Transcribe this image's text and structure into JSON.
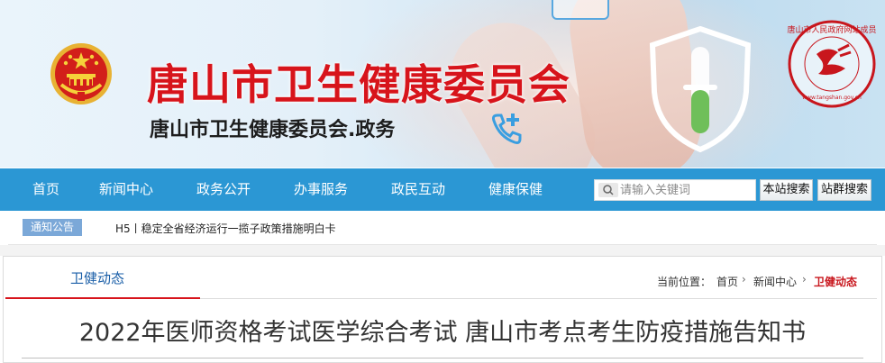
{
  "header": {
    "title": "唐山市卫生健康委员会",
    "subtitle": "唐山市卫生健康委员会.政务",
    "seal_text": "唐山市人民政府网站成员",
    "seal_url": "www.tangshan.gov.cn"
  },
  "nav": {
    "items": [
      {
        "label": "首页"
      },
      {
        "label": "新闻中心"
      },
      {
        "label": "政务公开"
      },
      {
        "label": "办事服务"
      },
      {
        "label": "政民互动"
      },
      {
        "label": "健康保健"
      }
    ],
    "search_placeholder": "请输入关键词",
    "search_site_label": "本站搜索",
    "search_group_label": "站群搜索"
  },
  "notice": {
    "badge": "通知公告",
    "text": "H5丨稳定全省经济运行一揽子政策措施明白卡"
  },
  "section": {
    "tab_label": "卫健动态",
    "breadcrumb_prefix": "当前位置：",
    "breadcrumb": [
      "首页",
      "新闻中心",
      "卫健动态"
    ]
  },
  "article": {
    "title": "2022年医师资格考试医学综合考试 唐山市考点考生防疫措施告知书"
  },
  "colors": {
    "brand_red": "#d7141b",
    "nav_blue": "#2b97d4",
    "badge_blue": "#7ba8d8"
  },
  "icons": {
    "emblem": "national-emblem-icon",
    "search": "search-icon",
    "seal": "government-seal-icon",
    "shield": "shield-capsule-icon",
    "phone": "phone-plus-icon"
  }
}
